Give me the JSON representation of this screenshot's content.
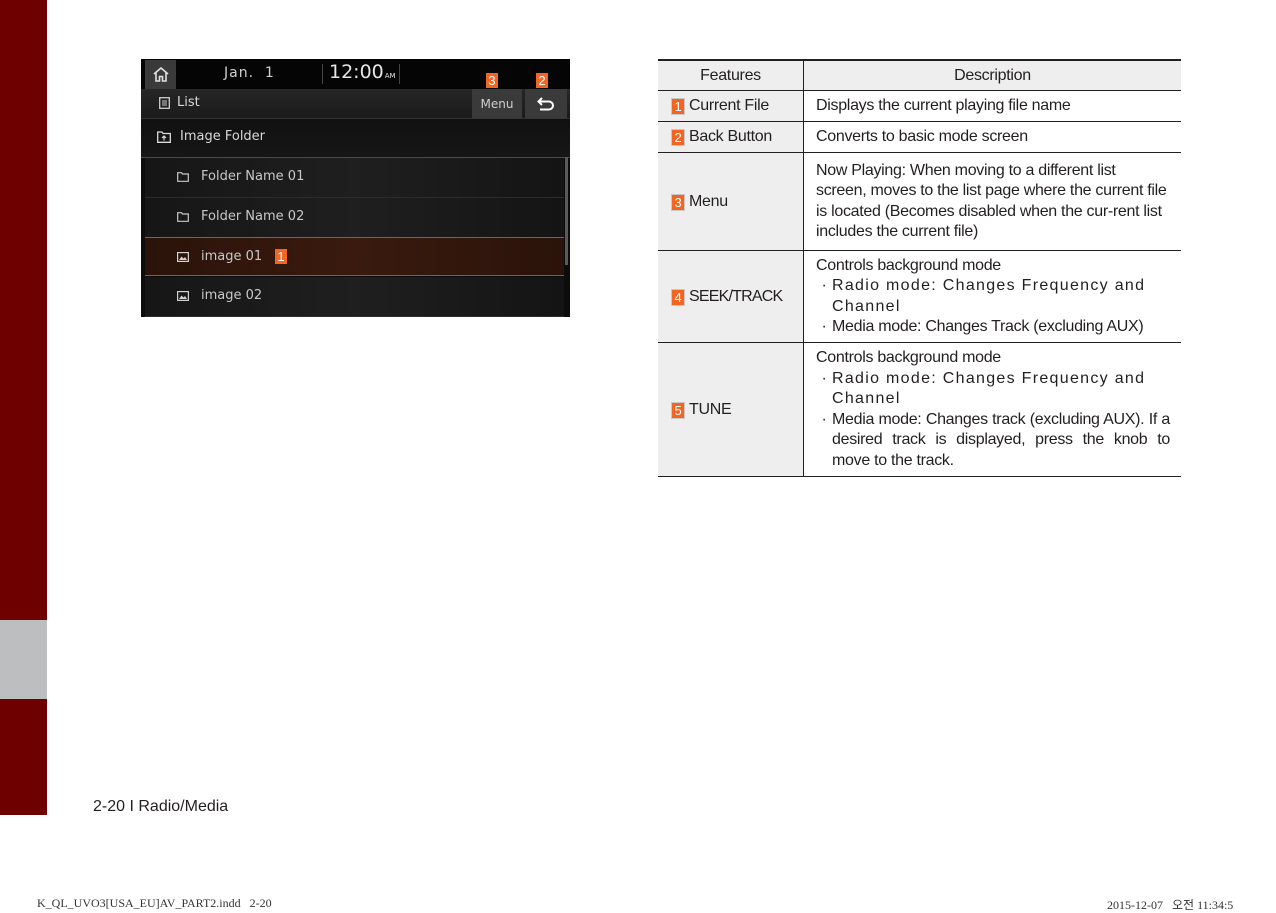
{
  "screen": {
    "status": {
      "date": "Jan.  1",
      "time": "12:00",
      "ampm": "AM"
    },
    "title": "List",
    "menu_label": "Menu",
    "folder_up_label": "Image Folder",
    "items": [
      {
        "label": "Folder Name 01",
        "type": "folder",
        "selected": false
      },
      {
        "label": "Folder Name 02",
        "type": "folder",
        "selected": false
      },
      {
        "label": "image 01",
        "type": "image",
        "selected": true
      },
      {
        "label": "image 02",
        "type": "image",
        "selected": false
      }
    ],
    "callouts": {
      "current_file": "1",
      "back": "2",
      "menu": "3"
    },
    "accent_color": "#f26522"
  },
  "table": {
    "headers": [
      "Features",
      "Description"
    ],
    "rows": [
      {
        "num": "1",
        "feature": "Current File",
        "desc": "Displays the current playing file name"
      },
      {
        "num": "2",
        "feature": "Back Button",
        "desc": "Converts to basic mode screen"
      },
      {
        "num": "3",
        "feature": "Menu",
        "desc": "Now Playing: When moving to a different list screen, moves to the list page where the current file is located (Becomes disabled when the cur-rent list includes the current file)"
      },
      {
        "num": "4",
        "feature": "SEEK/TRACK",
        "desc": "Controls background mode",
        "bullets": [
          "Radio mode: Changes Frequency and Channel",
          "Media mode: Changes Track (excluding AUX)"
        ]
      },
      {
        "num": "5",
        "feature": "TUNE",
        "desc": "Controls background mode",
        "bullets": [
          "Radio mode: Changes Frequency and Channel",
          "Media mode: Changes track (excluding AUX). If a desired track is displayed, press the knob to move to the track."
        ]
      }
    ]
  },
  "footer": {
    "page_label": "2-20 I Radio/Media",
    "slug_left": "K_QL_UVO3[USA_EU]AV_PART2.indd   2-20",
    "slug_right": "2015-12-07   오전 11:34:5"
  },
  "colors": {
    "sidebar": "#6e0000",
    "sidebar_tab": "#bcbec0",
    "badge": "#f26522"
  }
}
